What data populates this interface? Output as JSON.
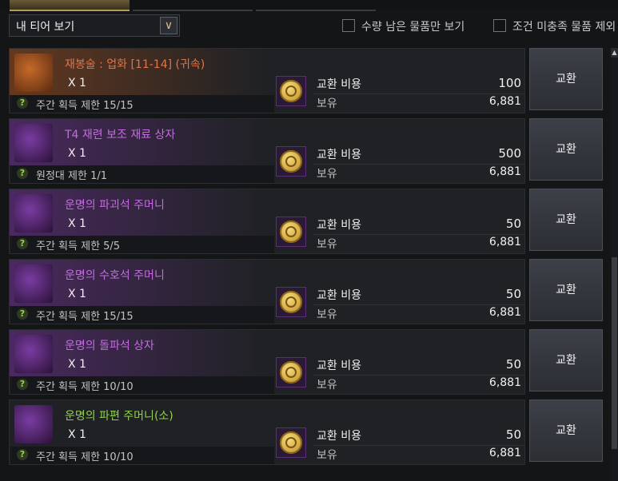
{
  "filters": {
    "tier_dropdown": "내 티어 보기",
    "dropdown_arrow": "∨",
    "remaining_only": "수량 남은 물품만 보기",
    "exclude_unmet": "조건 미충족 물품 제외"
  },
  "labels": {
    "cost": "교환 비용",
    "own": "보유",
    "exchange_button": "교환",
    "qty": "X 1",
    "help": "?"
  },
  "items": [
    {
      "name": "재봉술 : 업화 [11-14] (귀속)",
      "name_color": "#e0744a",
      "glow": "orange",
      "limit": "주간 획득 제한 15/15",
      "cost": "100",
      "own": "6,881"
    },
    {
      "name": "T4 재련 보조 재료 상자",
      "name_color": "#c46be0",
      "glow": "purple",
      "limit": "원정대 제한 1/1",
      "cost": "500",
      "own": "6,881"
    },
    {
      "name": "운명의 파괴석 주머니",
      "name_color": "#c46be0",
      "glow": "purple",
      "limit": "주간 획득 제한 5/5",
      "cost": "50",
      "own": "6,881"
    },
    {
      "name": "운명의 수호석 주머니",
      "name_color": "#c46be0",
      "glow": "purple",
      "limit": "주간 획득 제한 15/15",
      "cost": "50",
      "own": "6,881"
    },
    {
      "name": "운명의 돌파석 상자",
      "name_color": "#c46be0",
      "glow": "purple",
      "limit": "주간 획득 제한 10/10",
      "cost": "50",
      "own": "6,881"
    },
    {
      "name": "운명의 파편 주머니(소)",
      "name_color": "#8fd14f",
      "glow": "none",
      "limit": "주간 획득 제한 10/10",
      "cost": "50",
      "own": "6,881"
    }
  ],
  "scrollbar": {
    "up_arrow": "▲"
  }
}
